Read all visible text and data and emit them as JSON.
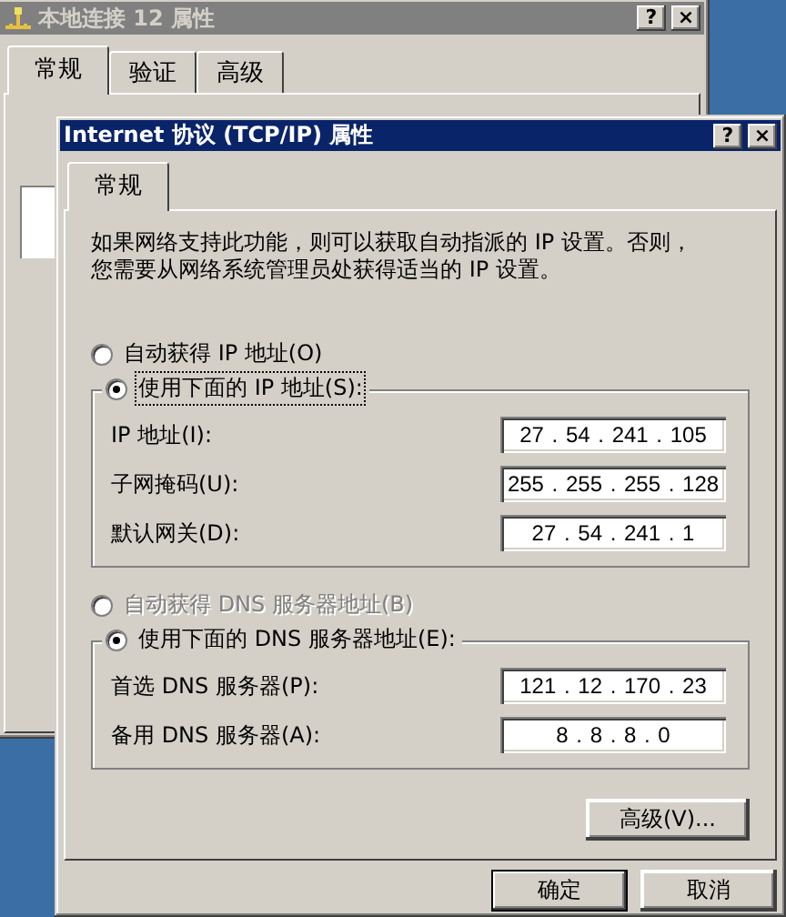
{
  "background_window": {
    "title": "本地连接 12 属性",
    "title_buttons": [
      "?",
      "×"
    ],
    "tabs": [
      {
        "label": "常规",
        "selected": true
      },
      {
        "label": "验证",
        "selected": false
      },
      {
        "label": "高级",
        "selected": false
      }
    ]
  },
  "dialog": {
    "title": "Internet 协议 (TCP/IP) 属性",
    "title_buttons": [
      "?",
      "×"
    ],
    "tabs": [
      {
        "label": "常规",
        "selected": true
      }
    ],
    "description_lines": [
      "如果网络支持此功能，则可以获取自动指派的 IP 设置。否则，",
      "您需要从网络系统管理员处获得适当的 IP 设置。"
    ],
    "ip": {
      "auto_option": {
        "label": "自动获得 IP 地址(O)",
        "selected": false,
        "disabled": false,
        "focused": false
      },
      "manual_option": {
        "label": "使用下面的 IP 地址(S):",
        "selected": true,
        "disabled": false,
        "focused": true
      },
      "fields": [
        {
          "label": "IP 地址(I):",
          "value": "27 . 54 . 241 . 105"
        },
        {
          "label": "子网掩码(U):",
          "value": "255 . 255 . 255 . 128"
        },
        {
          "label": "默认网关(D):",
          "value": "27 . 54 . 241 . 1"
        }
      ]
    },
    "dns": {
      "auto_option": {
        "label": "自动获得 DNS 服务器地址(B)",
        "selected": false,
        "disabled": true,
        "focused": false
      },
      "manual_option": {
        "label": "使用下面的 DNS 服务器地址(E):",
        "selected": true,
        "disabled": false,
        "focused": false
      },
      "fields": [
        {
          "label": "首选 DNS 服务器(P):",
          "value": "121 . 12 . 170 . 23"
        },
        {
          "label": "备用 DNS 服务器(A):",
          "value": "8 . 8 . 8 . 0"
        }
      ]
    },
    "advanced_button": "高级(V)...",
    "buttons": [
      {
        "label": "确定",
        "default": true
      },
      {
        "label": "取消",
        "default": false
      }
    ]
  }
}
